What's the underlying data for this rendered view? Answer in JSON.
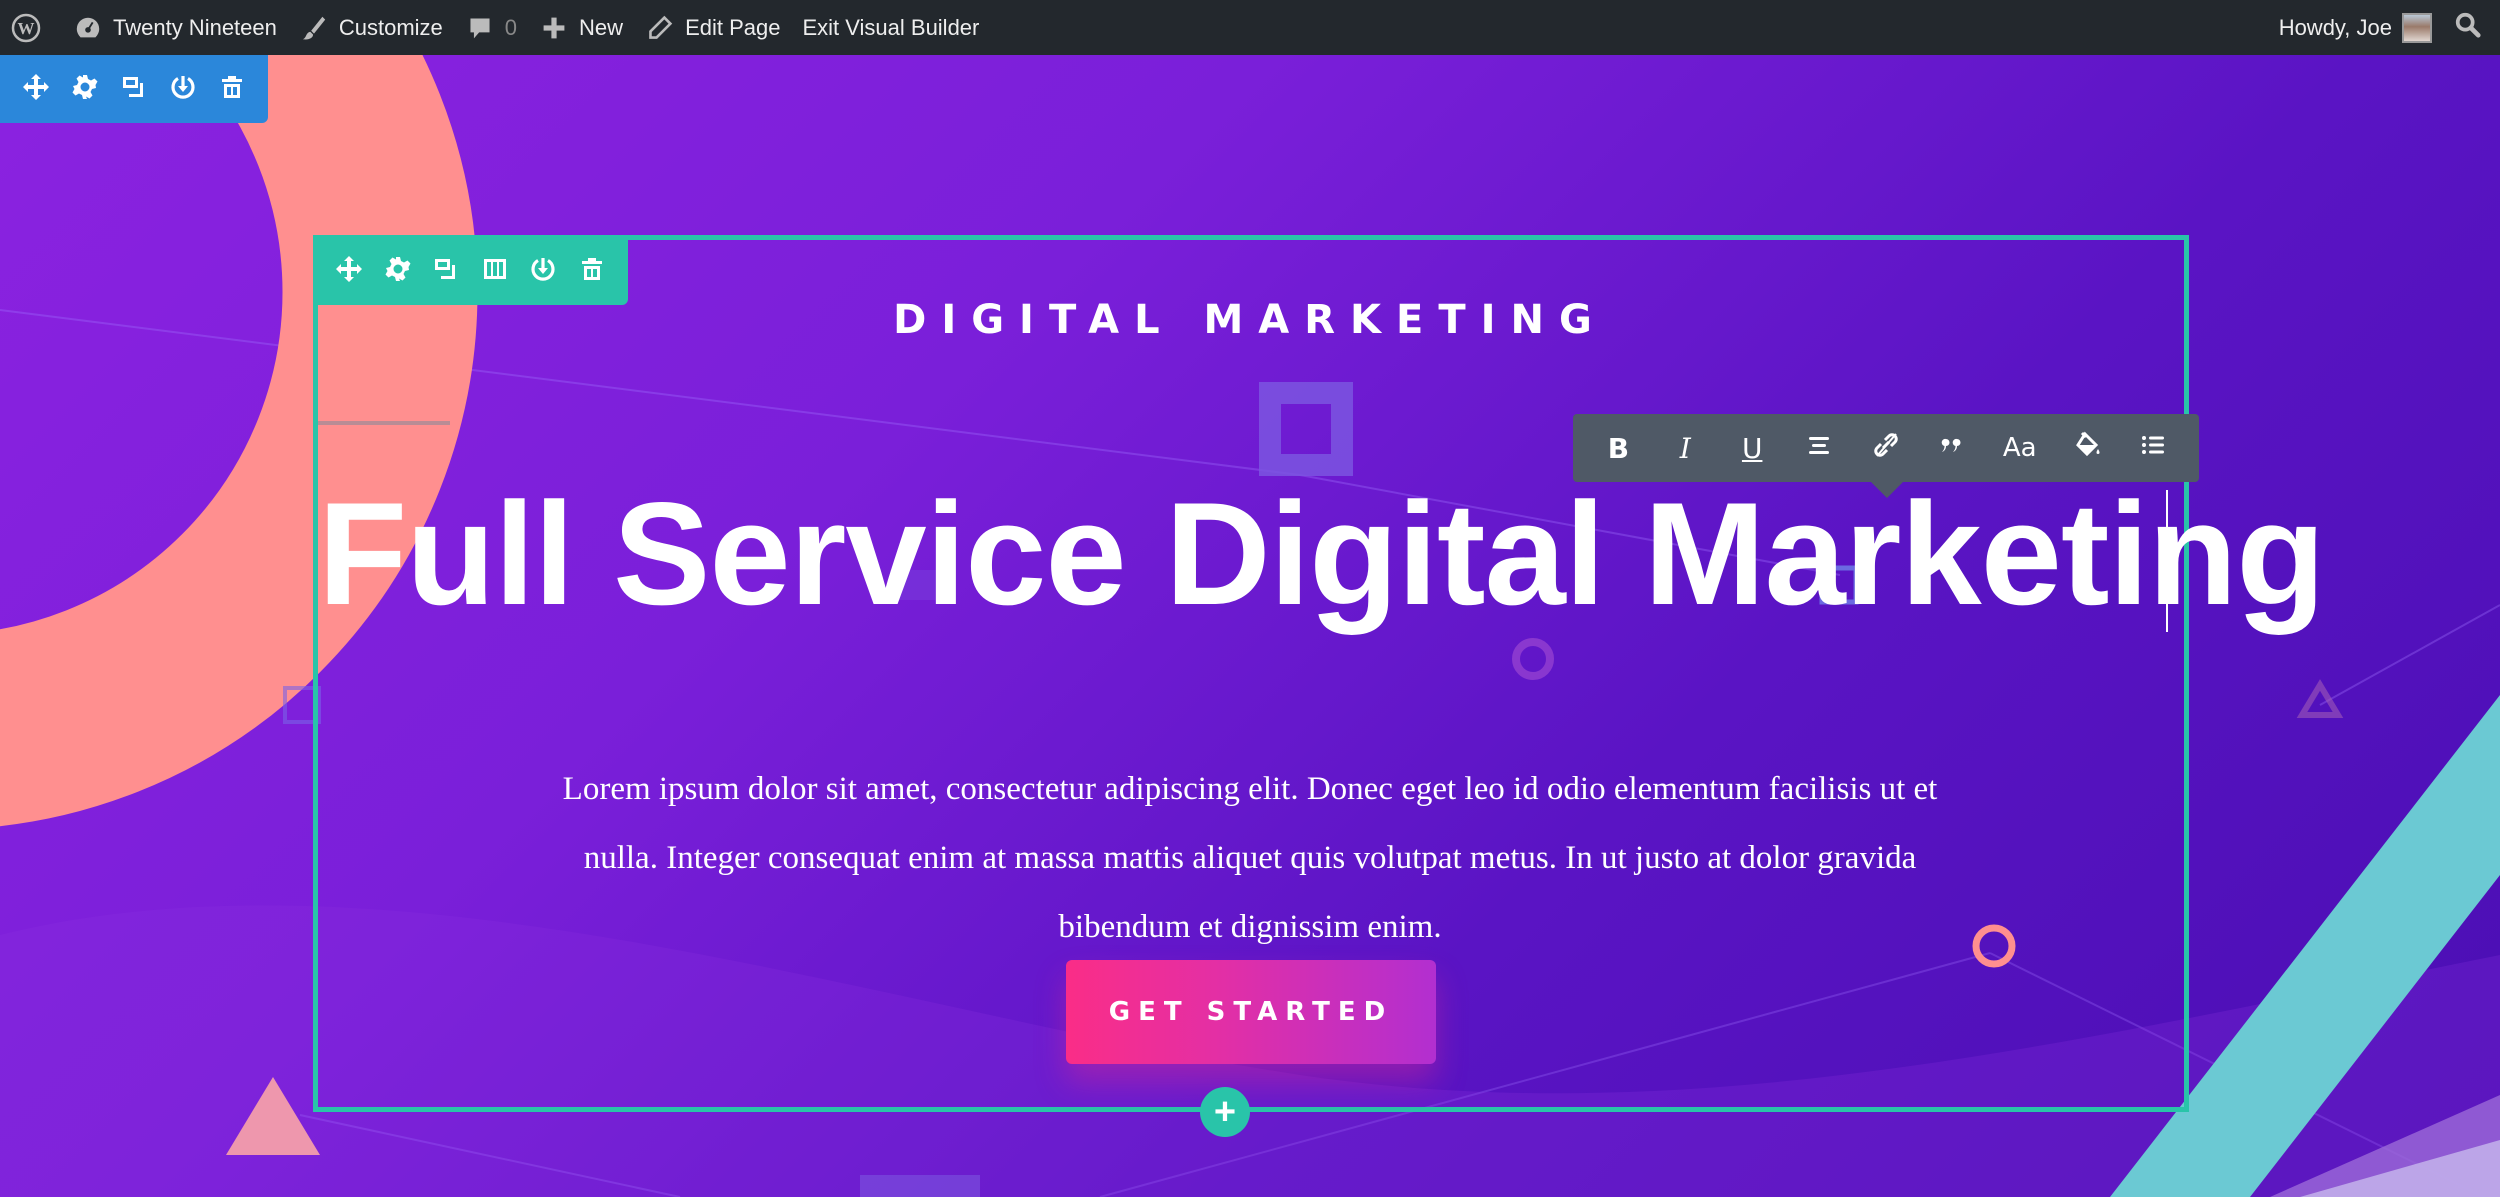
{
  "admin_bar": {
    "items": [
      {
        "id": "wp-logo",
        "label": "",
        "icon": "wordpress-icon"
      },
      {
        "id": "site",
        "label": "Twenty Nineteen",
        "icon": "dashboard-icon"
      },
      {
        "id": "customize",
        "label": "Customize",
        "icon": "paintbrush-icon"
      },
      {
        "id": "comments",
        "label": "0",
        "icon": "comment-icon"
      },
      {
        "id": "new",
        "label": "New",
        "icon": "plus-icon"
      },
      {
        "id": "edit",
        "label": "Edit Page",
        "icon": "pencil-icon"
      },
      {
        "id": "exit",
        "label": "Exit Visual Builder",
        "icon": ""
      }
    ],
    "greeting": "Howdy, Joe",
    "search_icon": "search-icon"
  },
  "section_toolbar": {
    "color": "#2b87da",
    "buttons": [
      "move-icon",
      "gear-icon",
      "duplicate-icon",
      "save-to-library-icon",
      "trash-icon"
    ]
  },
  "row_toolbar": {
    "color": "#29c4a9",
    "buttons": [
      "move-icon",
      "gear-icon",
      "duplicate-icon",
      "columns-icon",
      "save-to-library-icon",
      "trash-icon"
    ]
  },
  "text_toolbar": {
    "buttons": [
      {
        "name": "bold",
        "label": "B"
      },
      {
        "name": "italic",
        "label": "I"
      },
      {
        "name": "underline",
        "label": "U"
      },
      {
        "name": "align",
        "label": ""
      },
      {
        "name": "link",
        "label": ""
      },
      {
        "name": "quote",
        "label": "”"
      },
      {
        "name": "font",
        "label": "Aa"
      },
      {
        "name": "text-color",
        "label": ""
      },
      {
        "name": "list",
        "label": ""
      }
    ]
  },
  "hero": {
    "subtitle": "DIGITAL MARKETING",
    "headline": "Full Service Digital Marketing",
    "body": "Lorem ipsum dolor sit amet, consectetur adipiscing elit. Donec eget leo id odio elementum facilisis ut et nulla. Integer consequat enim at massa mattis aliquet quis volutpat metus. In ut justo at dolor gravida bibendum et dignissim enim.",
    "cta_label": "GET STARTED",
    "add_row_label": "+"
  },
  "colors": {
    "accent_green": "#29c4a9",
    "accent_blue": "#2b87da",
    "cta_start": "#fa2d87",
    "cta_end": "#b22fd0",
    "shape_coral": "#ff8f8f",
    "shape_teal": "#6bc9d3"
  }
}
